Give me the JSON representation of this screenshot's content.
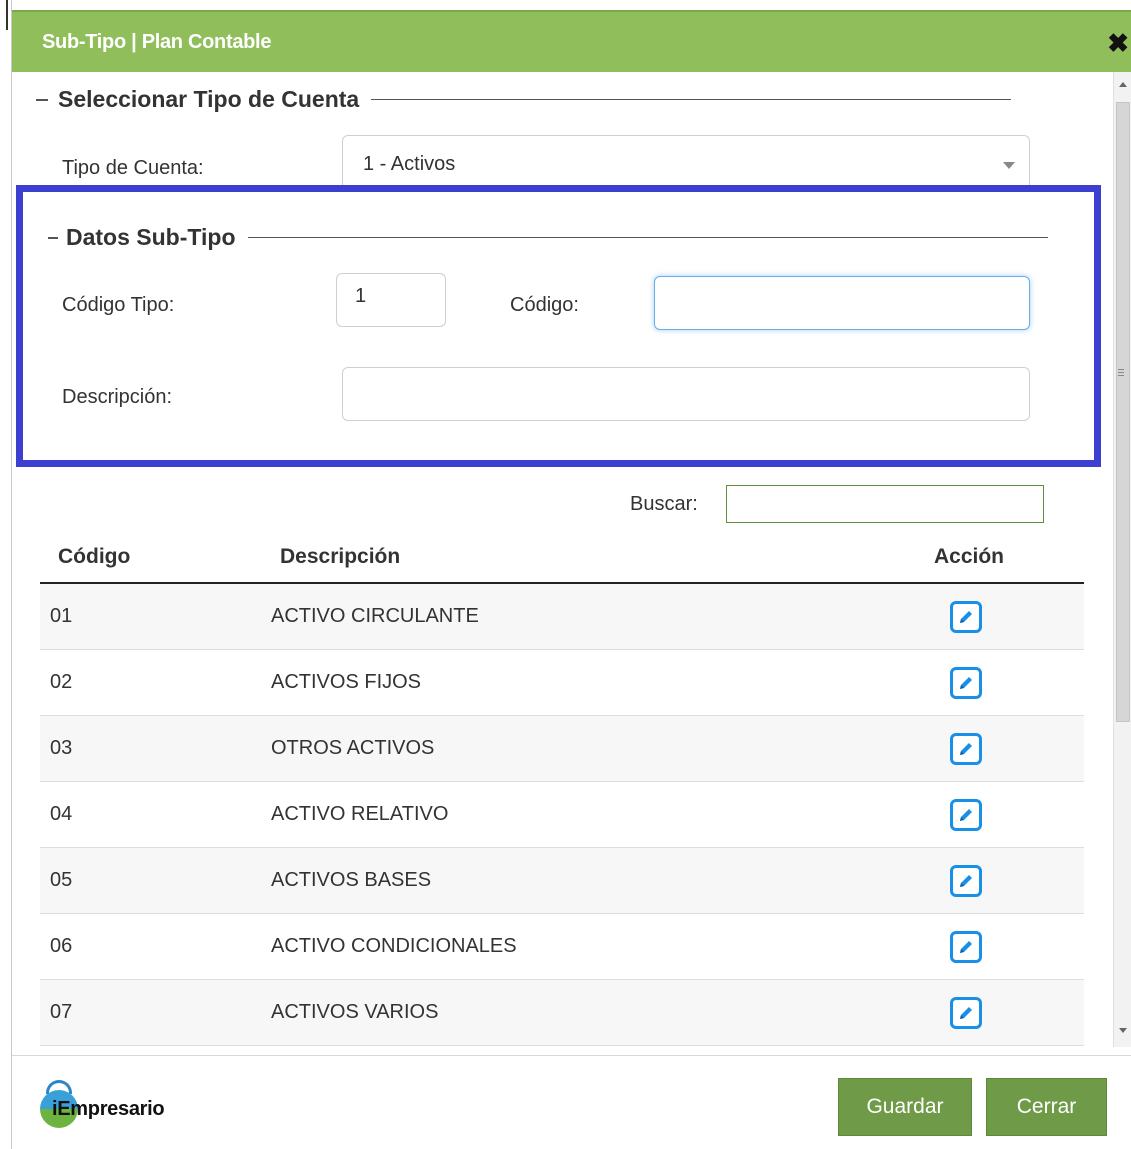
{
  "dialog": {
    "title": "Sub-Tipo | Plan Contable",
    "close_icon": "✖"
  },
  "section_tipo": {
    "legend": "Seleccionar Tipo de Cuenta",
    "tipo_label": "Tipo de Cuenta:",
    "tipo_value": "1 - Activos"
  },
  "section_datos": {
    "legend": "Datos Sub-Tipo",
    "codigo_tipo_label": "Código Tipo:",
    "codigo_tipo_value": "1",
    "codigo_label": "Código:",
    "codigo_value": "",
    "descripcion_label": "Descripción:",
    "descripcion_value": ""
  },
  "search": {
    "label": "Buscar:",
    "value": ""
  },
  "table": {
    "headers": {
      "code": "Código",
      "desc": "Descripción",
      "action": "Acción"
    },
    "rows": [
      {
        "code": "01",
        "desc": "ACTIVO CIRCULANTE"
      },
      {
        "code": "02",
        "desc": "ACTIVOS FIJOS"
      },
      {
        "code": "03",
        "desc": "OTROS ACTIVOS"
      },
      {
        "code": "04",
        "desc": "ACTIVO RELATIVO"
      },
      {
        "code": "05",
        "desc": "ACTIVOS BASES"
      },
      {
        "code": "06",
        "desc": "ACTIVO CONDICIONALES"
      },
      {
        "code": "07",
        "desc": "ACTIVOS VARIOS"
      }
    ]
  },
  "footer": {
    "brand": "iEmpresario",
    "save_label": "Guardar",
    "close_label": "Cerrar"
  },
  "colors": {
    "titlebar": "#8fbe5a",
    "highlight_border": "#3c3fcf",
    "button": "#6f9a47",
    "edit_icon": "#1a8fe8"
  }
}
